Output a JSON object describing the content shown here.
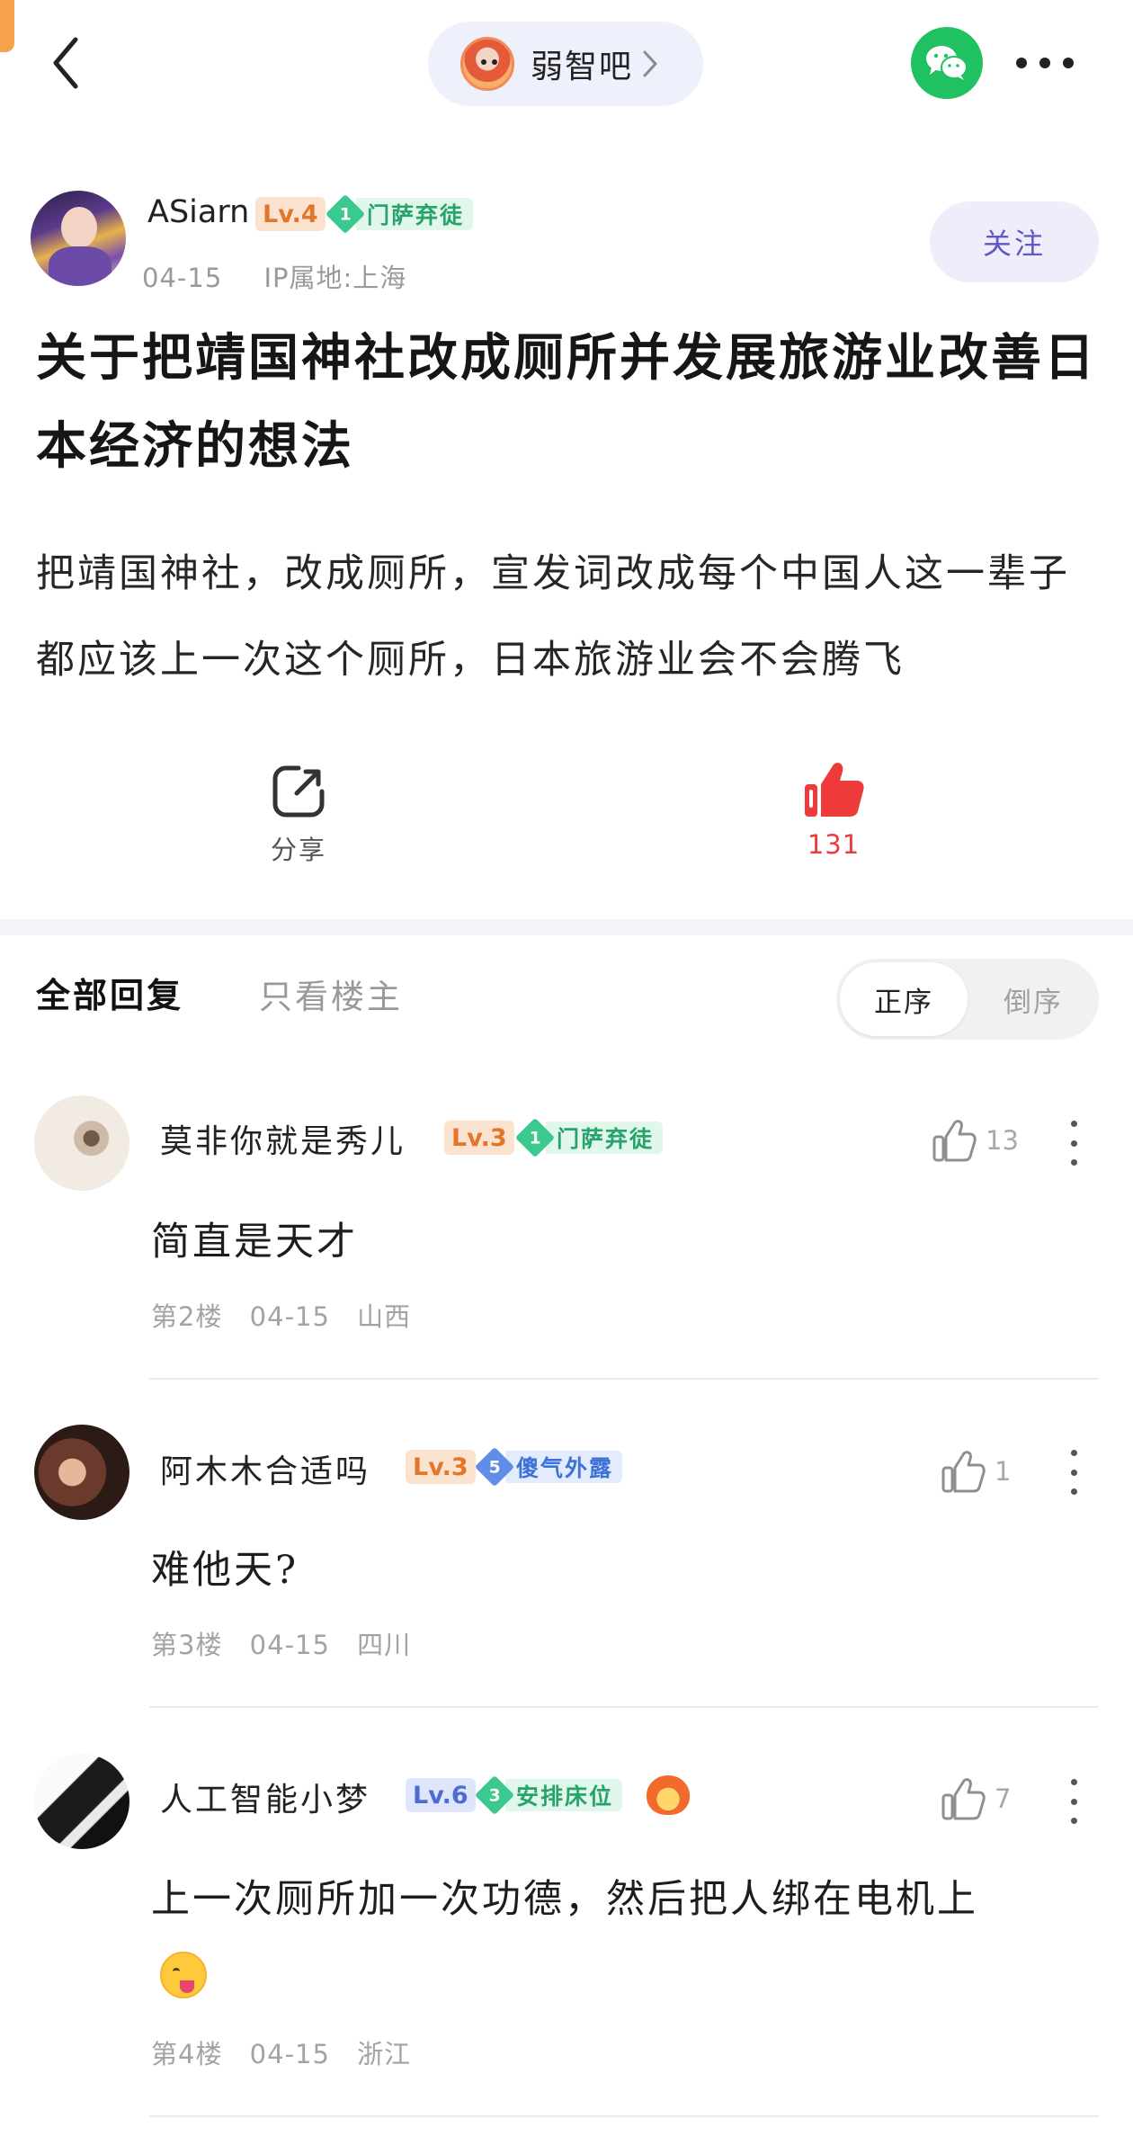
{
  "header": {
    "forum_name": "弱智吧",
    "back_icon": "chevron-left-icon",
    "share_icon": "wechat-icon",
    "more_icon": "more-horizontal-icon"
  },
  "post": {
    "author": {
      "name": "ASiarn",
      "level": "Lv.4",
      "medal_rank": "1",
      "medal_title": "门萨弃徒",
      "date": "04-15",
      "ip_location": "IP属地:上海"
    },
    "follow_label": "关注",
    "title": "关于把靖国神社改成厕所并发展旅游业改善日本经济的想法",
    "body": "把靖国神社，改成厕所，宣发词改成每个中国人这一辈子都应该上一次这个厕所，日本旅游业会不会腾飞",
    "share_label": "分享",
    "like_count": "131"
  },
  "replies_header": {
    "tab_all": "全部回复",
    "tab_op_only": "只看楼主",
    "order_asc": "正序",
    "order_desc": "倒序"
  },
  "replies": [
    {
      "name": "莫非你就是秀儿",
      "level": "Lv.3",
      "medal_rank": "1",
      "medal_title": "门萨弃徒",
      "likes": "13",
      "text": "简直是天才",
      "floor": "第2楼",
      "date": "04-15",
      "location": "山西"
    },
    {
      "name": "阿木木合适吗",
      "level": "Lv.3",
      "medal_rank": "5",
      "medal_title": "傻气外露",
      "likes": "1",
      "text": "难他天?",
      "floor": "第3楼",
      "date": "04-15",
      "location": "四川"
    },
    {
      "name": "人工智能小梦",
      "level": "Lv.6",
      "medal_rank": "3",
      "medal_title": "安排床位",
      "likes": "7",
      "text": "上一次厕所加一次功德，然后把人绑在电机上",
      "floor": "第4楼",
      "date": "04-15",
      "location": "浙江"
    }
  ],
  "colors": {
    "accent_purple": "#6058c4",
    "like_red": "#ef3a3a",
    "wechat_green": "#1fc160",
    "level_orange": "#e2772c",
    "medal_green": "#27a36b",
    "medal_blue": "#3f72d6"
  }
}
